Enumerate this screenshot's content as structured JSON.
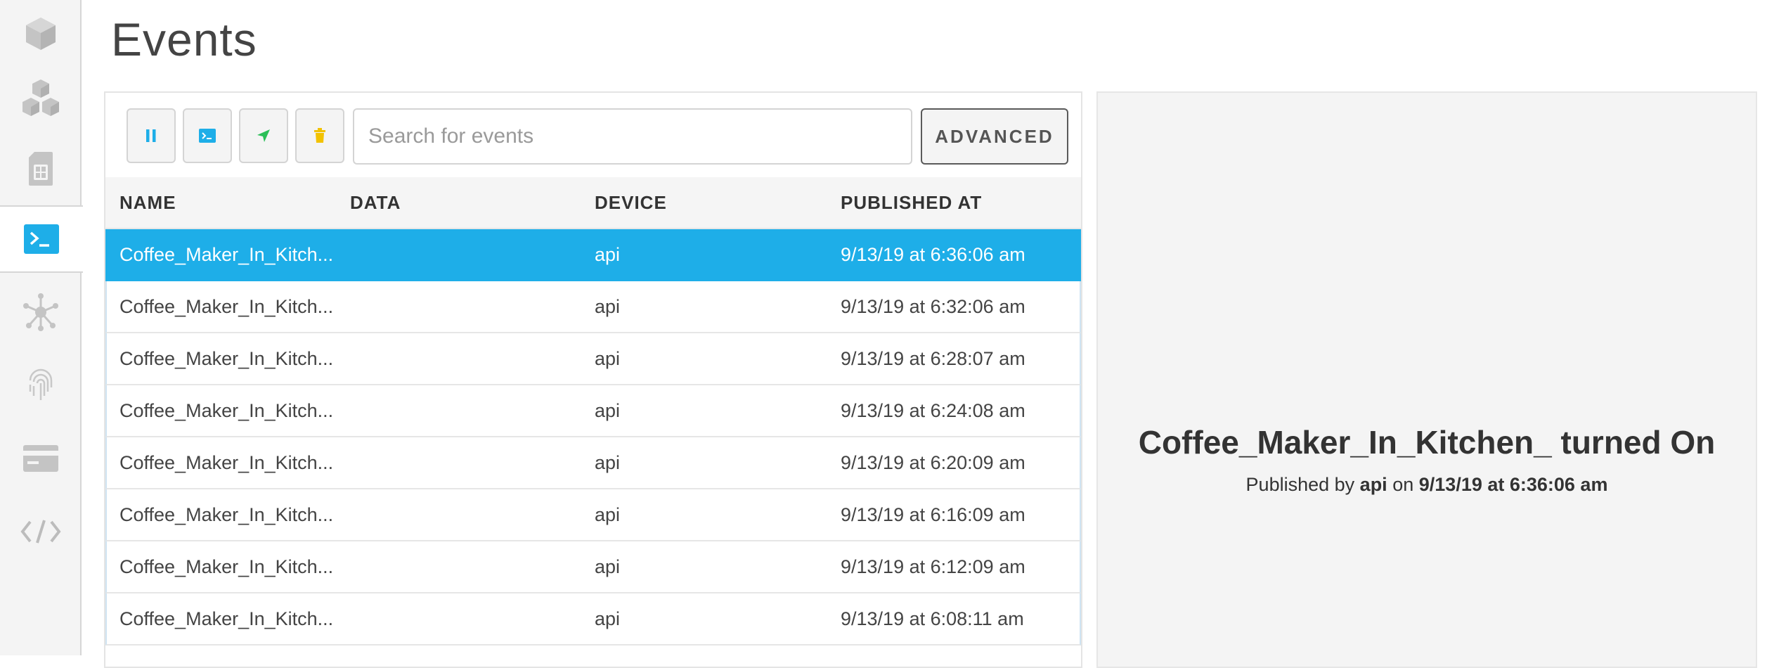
{
  "page": {
    "title": "Events"
  },
  "sidebar": {
    "items": [
      {
        "name": "device-icon"
      },
      {
        "name": "products-icon"
      },
      {
        "name": "sim-card-icon"
      },
      {
        "name": "console-icon",
        "active": true
      },
      {
        "name": "network-icon"
      },
      {
        "name": "fingerprint-icon"
      },
      {
        "name": "billing-icon"
      },
      {
        "name": "code-icon"
      }
    ],
    "accent": "#1eaee8"
  },
  "toolbar": {
    "search_placeholder": "Search for events",
    "advanced_label": "ADVANCED"
  },
  "table": {
    "columns": [
      "NAME",
      "DATA",
      "DEVICE",
      "PUBLISHED AT"
    ],
    "rows": [
      {
        "name": "Coffee_Maker_In_Kitch...",
        "data": "",
        "device": "api",
        "published_at": "9/13/19 at 6:36:06 am",
        "selected": true
      },
      {
        "name": "Coffee_Maker_In_Kitch...",
        "data": "",
        "device": "api",
        "published_at": "9/13/19 at 6:32:06 am"
      },
      {
        "name": "Coffee_Maker_In_Kitch...",
        "data": "",
        "device": "api",
        "published_at": "9/13/19 at 6:28:07 am"
      },
      {
        "name": "Coffee_Maker_In_Kitch...",
        "data": "",
        "device": "api",
        "published_at": "9/13/19 at 6:24:08 am"
      },
      {
        "name": "Coffee_Maker_In_Kitch...",
        "data": "",
        "device": "api",
        "published_at": "9/13/19 at 6:20:09 am"
      },
      {
        "name": "Coffee_Maker_In_Kitch...",
        "data": "",
        "device": "api",
        "published_at": "9/13/19 at 6:16:09 am"
      },
      {
        "name": "Coffee_Maker_In_Kitch...",
        "data": "",
        "device": "api",
        "published_at": "9/13/19 at 6:12:09 am"
      },
      {
        "name": "Coffee_Maker_In_Kitch...",
        "data": "",
        "device": "api",
        "published_at": "9/13/19 at 6:08:11 am"
      }
    ],
    "selected_color": "#1eaee8"
  },
  "detail": {
    "title": "Coffee_Maker_In_Kitchen_ turned On",
    "published_by_prefix": "Published by",
    "published_by": "api",
    "on_word": "on",
    "published_at": "9/13/19 at 6:36:06 am"
  }
}
